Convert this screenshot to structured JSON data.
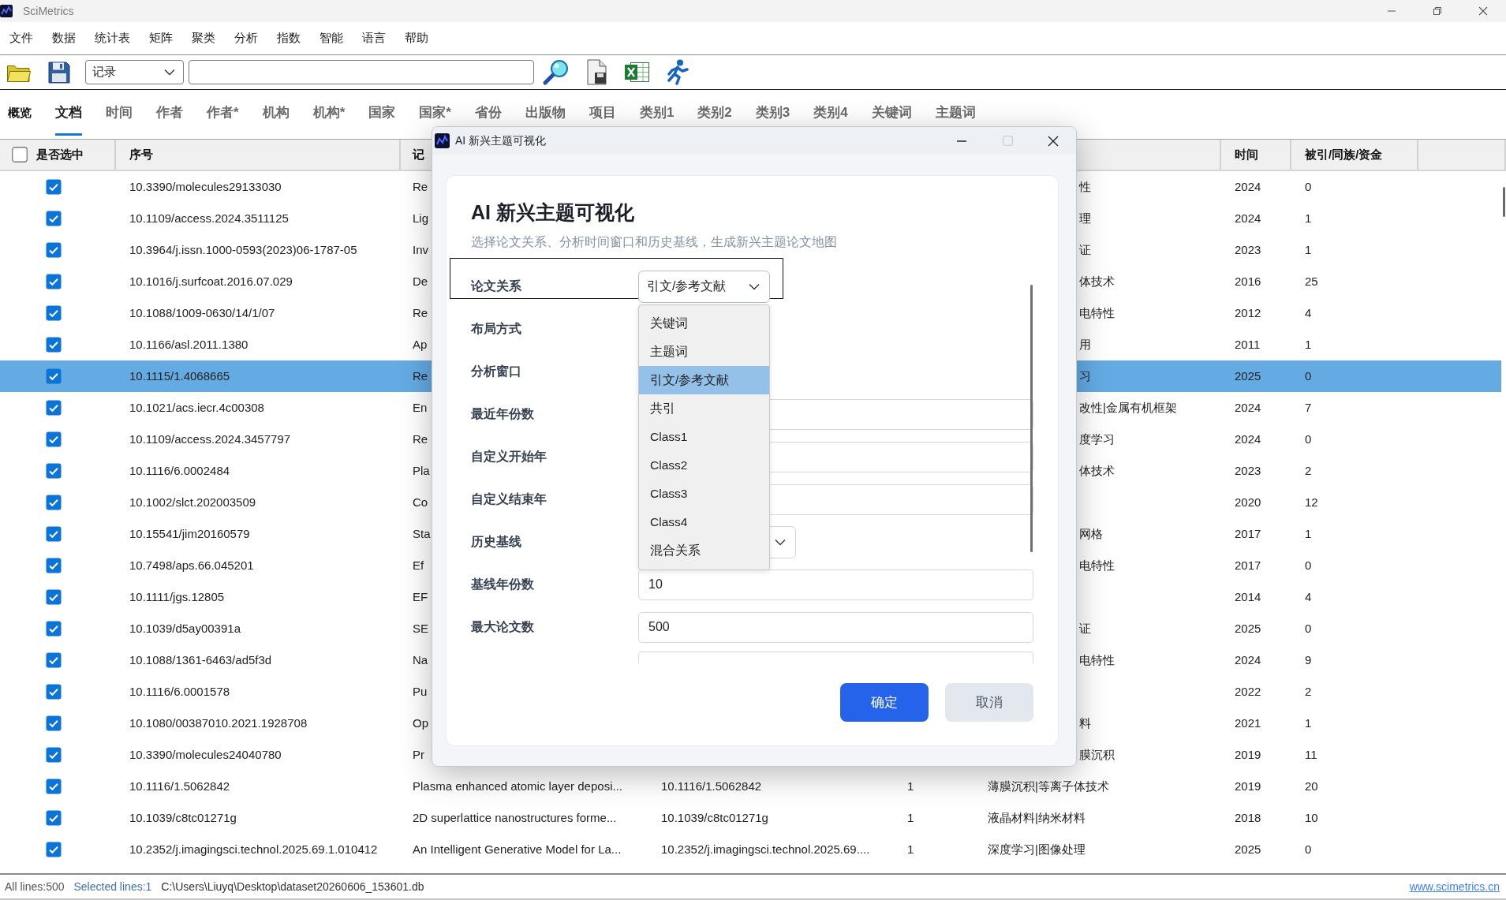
{
  "window": {
    "title": "SciMetrics"
  },
  "menu": [
    "文件",
    "数据",
    "统计表",
    "矩阵",
    "聚类",
    "分析",
    "指数",
    "智能",
    "语言",
    "帮助"
  ],
  "toolbar": {
    "record_select": "记录"
  },
  "tabs": [
    {
      "label": "概览",
      "kind": "overview",
      "selected": false
    },
    {
      "label": "文档",
      "kind": "tab",
      "selected": true
    },
    {
      "label": "时间",
      "kind": "tab",
      "selected": false
    },
    {
      "label": "作者",
      "kind": "tab",
      "selected": false
    },
    {
      "label": "作者*",
      "kind": "tab",
      "selected": false
    },
    {
      "label": "机构",
      "kind": "tab",
      "selected": false
    },
    {
      "label": "机构*",
      "kind": "tab",
      "selected": false
    },
    {
      "label": "国家",
      "kind": "tab",
      "selected": false
    },
    {
      "label": "国家*",
      "kind": "tab",
      "selected": false
    },
    {
      "label": "省份",
      "kind": "tab",
      "selected": false
    },
    {
      "label": "出版物",
      "kind": "tab",
      "selected": false
    },
    {
      "label": "项目",
      "kind": "tab",
      "selected": false
    },
    {
      "label": "类别1",
      "kind": "tab",
      "selected": false
    },
    {
      "label": "类别2",
      "kind": "tab",
      "selected": false
    },
    {
      "label": "类别3",
      "kind": "tab",
      "selected": false
    },
    {
      "label": "类别4",
      "kind": "tab",
      "selected": false
    },
    {
      "label": "关键词",
      "kind": "tab",
      "selected": false
    },
    {
      "label": "主题词",
      "kind": "tab",
      "selected": false
    }
  ],
  "table": {
    "header": {
      "select_all": {
        "label": "是否选中",
        "checked": false
      },
      "serial_no": "序号",
      "column_3": "记",
      "time": "时间",
      "cited": "被引/同族/资金"
    },
    "rows": [
      {
        "checked": true,
        "selected": false,
        "serial_no": "10.3390/molecules29133030",
        "column_3": "Re",
        "column_6": "性",
        "time": "2024",
        "cited": "0"
      },
      {
        "checked": true,
        "selected": false,
        "serial_no": "10.1109/access.2024.3511125",
        "column_3": "Lig",
        "column_6": "理",
        "time": "2024",
        "cited": "1"
      },
      {
        "checked": true,
        "selected": false,
        "serial_no": "10.3964/j.issn.1000-0593(2023)06-1787-05",
        "column_3": "Inv",
        "column_6": "证",
        "time": "2023",
        "cited": "1"
      },
      {
        "checked": true,
        "selected": false,
        "serial_no": "10.1016/j.surfcoat.2016.07.029",
        "column_3": "De",
        "column_6": "体技术",
        "time": "2016",
        "cited": "25"
      },
      {
        "checked": true,
        "selected": false,
        "serial_no": "10.1088/1009-0630/14/1/07",
        "column_3": "Re",
        "column_6": "电特性",
        "time": "2012",
        "cited": "4"
      },
      {
        "checked": true,
        "selected": false,
        "serial_no": "10.1166/asl.2011.1380",
        "column_3": "Ap",
        "column_6": "用",
        "time": "2011",
        "cited": "1"
      },
      {
        "checked": true,
        "selected": true,
        "serial_no": "10.1115/1.4068665",
        "column_3": "Re",
        "column_6": "习",
        "time": "2025",
        "cited": "0"
      },
      {
        "checked": true,
        "selected": false,
        "serial_no": "10.1021/acs.iecr.4c00308",
        "column_3": "En",
        "column_6": "改性|金属有机框架",
        "time": "2024",
        "cited": "7"
      },
      {
        "checked": true,
        "selected": false,
        "serial_no": "10.1109/access.2024.3457797",
        "column_3": "Re",
        "column_6": "度学习",
        "time": "2024",
        "cited": "0"
      },
      {
        "checked": true,
        "selected": false,
        "serial_no": "10.1116/6.0002484",
        "column_3": "Pla",
        "column_6": "体技术",
        "time": "2023",
        "cited": "2"
      },
      {
        "checked": true,
        "selected": false,
        "serial_no": "10.1002/slct.202003509",
        "column_3": "Co",
        "time": "2020",
        "cited": "12"
      },
      {
        "checked": true,
        "selected": false,
        "serial_no": "10.15541/jim20160579",
        "column_3": "Sta",
        "column_6": "网格",
        "time": "2017",
        "cited": "1"
      },
      {
        "checked": true,
        "selected": false,
        "serial_no": "10.7498/aps.66.045201",
        "column_3": "Ef",
        "column_6": "电特性",
        "time": "2017",
        "cited": "0"
      },
      {
        "checked": true,
        "selected": false,
        "serial_no": "10.1111/jgs.12805",
        "column_3": "EF",
        "time": "2014",
        "cited": "4"
      },
      {
        "checked": true,
        "selected": false,
        "serial_no": "10.1039/d5ay00391a",
        "column_3": "SE",
        "column_6": "证",
        "time": "2025",
        "cited": "0"
      },
      {
        "checked": true,
        "selected": false,
        "serial_no": "10.1088/1361-6463/ad5f3d",
        "column_3": "Na",
        "column_6": "电特性",
        "time": "2024",
        "cited": "9"
      },
      {
        "checked": true,
        "selected": false,
        "serial_no": "10.1116/6.0001578",
        "column_3": "Pu",
        "time": "2022",
        "cited": "2"
      },
      {
        "checked": true,
        "selected": false,
        "serial_no": "10.1080/00387010.2021.1928708",
        "column_3": "Op",
        "column_6": "料",
        "time": "2021",
        "cited": "1"
      },
      {
        "checked": true,
        "selected": false,
        "serial_no": "10.3390/molecules24040780",
        "column_3": "Pr",
        "column_6": "膜沉积",
        "time": "2019",
        "cited": "11"
      },
      {
        "checked": true,
        "selected": false,
        "serial_no": "10.1116/1.5062842",
        "column_3": "Plasma enhanced atomic layer deposi...",
        "column_4": "10.1116/1.5062842",
        "column_5": "1",
        "column_6": "薄膜沉积|等离子体技术",
        "time": "2019",
        "cited": "20"
      },
      {
        "checked": true,
        "selected": false,
        "serial_no": "10.1039/c8tc01271g",
        "column_3": "2D superlattice nanostructures forme...",
        "column_4": "10.1039/c8tc01271g",
        "column_5": "1",
        "column_6": "液晶材料|纳米材料",
        "time": "2018",
        "cited": "10"
      },
      {
        "checked": true,
        "selected": false,
        "serial_no": "10.2352/j.imagingsci.technol.2025.69.1.010412",
        "column_3": "An Intelligent Generative Model for La...",
        "column_4": "10.2352/j.imagingsci.technol.2025.69....",
        "column_5": "1",
        "column_6": "深度学习|图像处理",
        "time": "2025",
        "cited": "0"
      }
    ]
  },
  "dialog": {
    "title": "AI 新兴主题可视化",
    "maximize_disabled": true,
    "heading": "AI 新兴主题可视化",
    "subtitle": "选择论文关系、分析时间窗口和历史基线，生成新兴主题论文地图",
    "fields": [
      {
        "kind": "select",
        "label": "论文关系",
        "value": "引文/参考文献",
        "focused": true,
        "expanded": true,
        "options": [
          {
            "label": "关键词",
            "selected": false
          },
          {
            "label": "主题词",
            "selected": false
          },
          {
            "label": "引文/参考文献",
            "selected": true
          },
          {
            "label": "共引",
            "selected": false
          },
          {
            "label": "Class1",
            "selected": false
          },
          {
            "label": "Class2",
            "selected": false
          },
          {
            "label": "Class3",
            "selected": false
          },
          {
            "label": "Class4",
            "selected": false
          },
          {
            "label": "混合关系",
            "selected": false
          }
        ]
      },
      {
        "kind": "label",
        "label": "布局方式"
      },
      {
        "kind": "label",
        "label": "分析窗口"
      },
      {
        "kind": "input",
        "label": "最近年份数"
      },
      {
        "kind": "input",
        "label": "自定义开始年"
      },
      {
        "kind": "input",
        "label": "自定义结束年"
      },
      {
        "kind": "select",
        "label": "历史基线",
        "focused": false,
        "expanded": false
      },
      {
        "kind": "input",
        "label": "基线年份数",
        "value": "10"
      },
      {
        "kind": "input",
        "label": "最大论文数",
        "value": "500"
      },
      {
        "kind": "clipped"
      }
    ],
    "buttons": [
      {
        "label": "确定",
        "kind": "primary"
      },
      {
        "label": "取消",
        "kind": "secondary"
      }
    ]
  },
  "status_bar": {
    "all_lines": "All lines:500",
    "selected_lines": "Selected lines:1",
    "path": "C:\\Users\\Liuyq\\Desktop\\dataset20260606_153601.db",
    "website": "www.scimetrics.cn"
  }
}
